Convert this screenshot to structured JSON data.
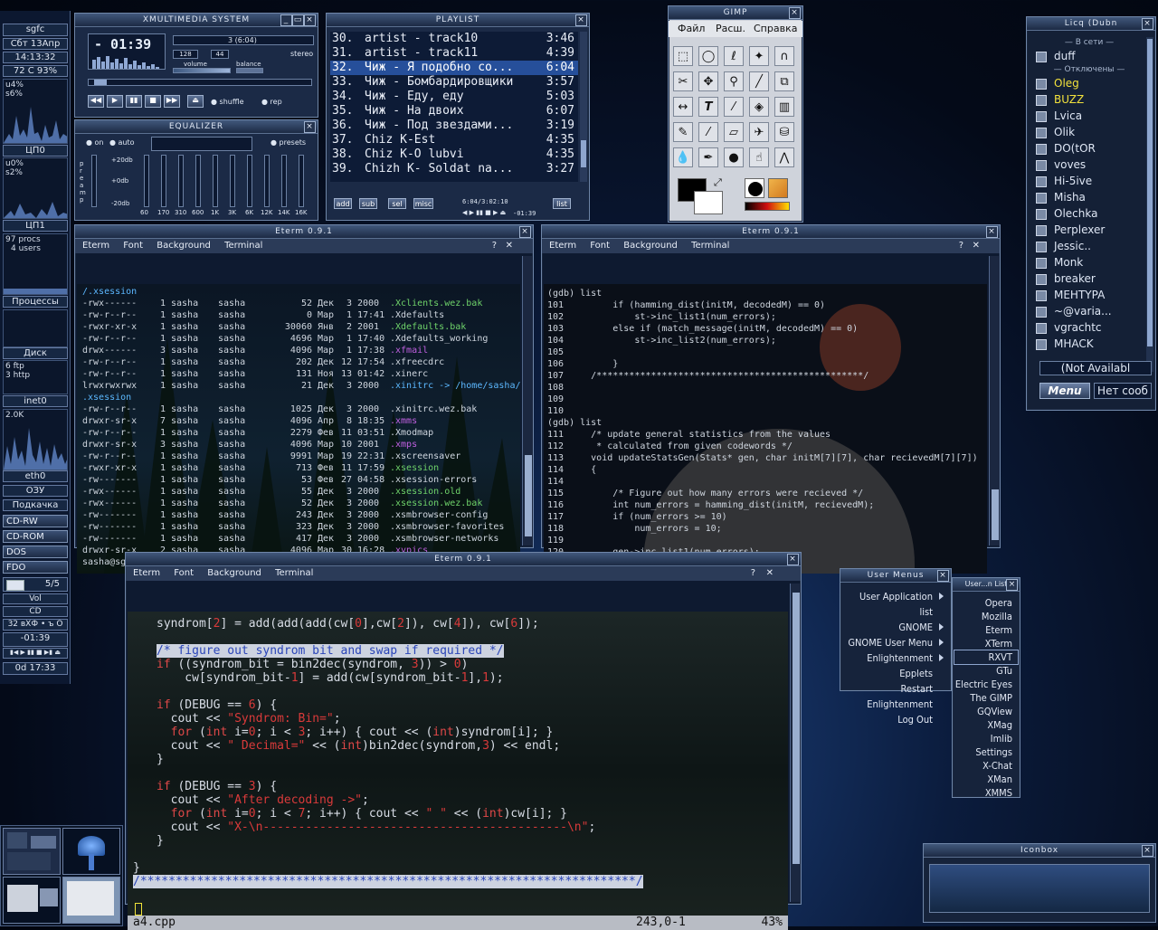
{
  "left_panel": {
    "host": "sgfc",
    "date": "Сбт 13Апр",
    "time": "14:13:32",
    "temp": "72 C 93%",
    "cpu0_pct": "u4%",
    "cpu0_sys": "s6%",
    "cpu0_label": "ЦП0",
    "cpu1_pct": "u0%",
    "cpu1_sys": "s2%",
    "cpu1_label": "ЦП1",
    "procs": "97 procs",
    "users": "4 users",
    "proc_label": "Процессы",
    "disk_label": "Диск",
    "ftp": "6 ftp",
    "http": "3 http",
    "inet_label": "inet0",
    "net_rate": "2.0K",
    "eth_label": "eth0",
    "ozu": "ОЗУ",
    "swap": "Подкачка",
    "mounts": [
      "CD-RW",
      "CD-ROM",
      "DOS",
      "FDO"
    ],
    "mail": "5/5",
    "vol": "Vol",
    "cd": "CD",
    "cd_info": "32 вХФ • ъ О",
    "cd_time": "-01:39",
    "uptime": "0d 17:33"
  },
  "xmms": {
    "title": "XMULTIMEDIA SYSTEM",
    "time": "- 01:39",
    "kbps": "128",
    "khz": "44",
    "stereo": "stereo",
    "volume": "volume",
    "balance": "balance",
    "shuffle": "shuffle",
    "rep": "rep",
    "song": "3 (6:04)",
    "eq_title": "EQUALIZER",
    "eq_on": "on",
    "eq_auto": "auto",
    "eq_presets": "presets",
    "eq_db": [
      "+20db",
      "+0db",
      "-20db"
    ],
    "eq_bands": [
      "60",
      "170",
      "310",
      "600",
      "1K",
      "3K",
      "6K",
      "12K",
      "14K",
      "16K"
    ],
    "eq_preamp": "preamp"
  },
  "playlist": {
    "title": "PLAYLIST",
    "rows": [
      {
        "num": "30.",
        "name": "artist - track10",
        "dur": "3:46"
      },
      {
        "num": "31.",
        "name": "artist - track11",
        "dur": "4:39"
      },
      {
        "num": "32.",
        "name": "Чиж - Я подобно со...",
        "dur": "6:04"
      },
      {
        "num": "33.",
        "name": "Чиж - Бомбардировщики",
        "dur": "3:57"
      },
      {
        "num": "34.",
        "name": "Чиж - Еду, еду",
        "dur": "5:03"
      },
      {
        "num": "35.",
        "name": "Чиж - На двоих",
        "dur": "6:07"
      },
      {
        "num": "36.",
        "name": "Чиж - Под звездами...",
        "dur": "3:19"
      },
      {
        "num": "37.",
        "name": "Chiz K-Est",
        "dur": "4:35"
      },
      {
        "num": "38.",
        "name": "Chiz K-O lubvi",
        "dur": "4:35"
      },
      {
        "num": "39.",
        "name": "Chizh K- Soldat na...",
        "dur": "3:27"
      }
    ],
    "buttons": [
      "add",
      "sub",
      "sel",
      "misc",
      "list"
    ],
    "info": "6:04/3:02:10",
    "remain": "-01:39"
  },
  "gimp": {
    "title": "GIMP",
    "menu": [
      "Файл",
      "Расш.",
      "Справка"
    ]
  },
  "eterm_left": {
    "title": "Eterm 0.9.1",
    "menu": [
      "Eterm",
      "Font",
      "Background",
      "Terminal"
    ],
    "header": "/.xsession",
    "rows": [
      {
        "perm": "-rwx------",
        "n": "1",
        "u": "sasha",
        "g": "sasha",
        "size": "52",
        "mon": "Дек",
        "day": "3",
        "t": "2000",
        "name": ".Xclients.wez.bak",
        "c": "grn"
      },
      {
        "perm": "-rw-r--r--",
        "n": "1",
        "u": "sasha",
        "g": "sasha",
        "size": "0",
        "mon": "Мар",
        "day": "1",
        "t": "17:41",
        "name": ".Xdefaults",
        "c": ""
      },
      {
        "perm": "-rwxr-xr-x",
        "n": "1",
        "u": "sasha",
        "g": "sasha",
        "size": "30060",
        "mon": "Янв",
        "day": "2",
        "t": "2001",
        "name": ".Xdefaults.bak",
        "c": "grn"
      },
      {
        "perm": "-rw-r--r--",
        "n": "1",
        "u": "sasha",
        "g": "sasha",
        "size": "4696",
        "mon": "Мар",
        "day": "1",
        "t": "17:40",
        "name": ".Xdefaults_working",
        "c": ""
      },
      {
        "perm": "drwx------",
        "n": "3",
        "u": "sasha",
        "g": "sasha",
        "size": "4096",
        "mon": "Мар",
        "day": "1",
        "t": "17:38",
        "name": ".xfmail",
        "c": "mag"
      },
      {
        "perm": "-rw-r--r--",
        "n": "1",
        "u": "sasha",
        "g": "sasha",
        "size": "202",
        "mon": "Дек",
        "day": "12",
        "t": "17:54",
        "name": ".xfreecdrc",
        "c": ""
      },
      {
        "perm": "-rw-r--r--",
        "n": "1",
        "u": "sasha",
        "g": "sasha",
        "size": "131",
        "mon": "Ноя",
        "day": "13",
        "t": "01:42",
        "name": ".xinerc",
        "c": ""
      },
      {
        "perm": "lrwxrwxrwx",
        "n": "1",
        "u": "sasha",
        "g": "sasha",
        "size": "21",
        "mon": "Дек",
        "day": "3",
        "t": "2000",
        "name": ".xinitrc -> /home/sasha/",
        "c": "cyanf"
      },
      {
        "perm": ".xsession",
        "n": "",
        "u": "",
        "g": "",
        "size": "",
        "mon": "",
        "day": "",
        "t": "",
        "name": "",
        "c": "cyanf"
      },
      {
        "perm": "-rw-r--r--",
        "n": "1",
        "u": "sasha",
        "g": "sasha",
        "size": "1025",
        "mon": "Дек",
        "day": "3",
        "t": "2000",
        "name": ".xinitrc.wez.bak",
        "c": ""
      },
      {
        "perm": "drwxr-sr-x",
        "n": "7",
        "u": "sasha",
        "g": "sasha",
        "size": "4096",
        "mon": "Апр",
        "day": "8",
        "t": "18:35",
        "name": ".xmms",
        "c": "mag"
      },
      {
        "perm": "-rw-r--r--",
        "n": "1",
        "u": "sasha",
        "g": "sasha",
        "size": "2279",
        "mon": "Фев",
        "day": "11",
        "t": "03:51",
        "name": ".Xmodmap",
        "c": ""
      },
      {
        "perm": "drwxr-sr-x",
        "n": "3",
        "u": "sasha",
        "g": "sasha",
        "size": "4096",
        "mon": "Мар",
        "day": "10",
        "t": "2001",
        "name": ".xmps",
        "c": "mag"
      },
      {
        "perm": "-rw-r--r--",
        "n": "1",
        "u": "sasha",
        "g": "sasha",
        "size": "9991",
        "mon": "Мар",
        "day": "19",
        "t": "22:31",
        "name": ".xscreensaver",
        "c": ""
      },
      {
        "perm": "-rwxr-xr-x",
        "n": "1",
        "u": "sasha",
        "g": "sasha",
        "size": "713",
        "mon": "Фев",
        "day": "11",
        "t": "17:59",
        "name": ".xsession",
        "c": "grn"
      },
      {
        "perm": "-rw-------",
        "n": "1",
        "u": "sasha",
        "g": "sasha",
        "size": "53",
        "mon": "Фев",
        "day": "27",
        "t": "04:58",
        "name": ".xsession-errors",
        "c": ""
      },
      {
        "perm": "-rwx------",
        "n": "1",
        "u": "sasha",
        "g": "sasha",
        "size": "55",
        "mon": "Дек",
        "day": "3",
        "t": "2000",
        "name": ".xsession.old",
        "c": "grn"
      },
      {
        "perm": "-rwx------",
        "n": "1",
        "u": "sasha",
        "g": "sasha",
        "size": "52",
        "mon": "Дек",
        "day": "3",
        "t": "2000",
        "name": ".xsession.wez.bak",
        "c": "grn"
      },
      {
        "perm": "-rw-------",
        "n": "1",
        "u": "sasha",
        "g": "sasha",
        "size": "243",
        "mon": "Дек",
        "day": "3",
        "t": "2000",
        "name": ".xsmbrowser-config",
        "c": ""
      },
      {
        "perm": "-rw-------",
        "n": "1",
        "u": "sasha",
        "g": "sasha",
        "size": "323",
        "mon": "Дек",
        "day": "3",
        "t": "2000",
        "name": ".xsmbrowser-favorites",
        "c": ""
      },
      {
        "perm": "-rw-------",
        "n": "1",
        "u": "sasha",
        "g": "sasha",
        "size": "417",
        "mon": "Дек",
        "day": "3",
        "t": "2000",
        "name": ".xsmbrowser-networks",
        "c": ""
      },
      {
        "perm": "drwxr-sr-x",
        "n": "2",
        "u": "sasha",
        "g": "sasha",
        "size": "4096",
        "mon": "Мар",
        "day": "30",
        "t": "16:28",
        "name": ".xvpics",
        "c": "mag"
      }
    ],
    "prompt": "sasha@sgfc:~$ "
  },
  "eterm_right": {
    "title": "Eterm 0.9.1",
    "menu": [
      "Eterm",
      "Font",
      "Background",
      "Terminal"
    ],
    "lines": [
      "(gdb) list",
      "101         if (hamming_dist(initM, decodedM) == 0)",
      "102             st->inc_list1(num_errors);",
      "103         else if (match_message(initM, decodedM) == 0)",
      "104             st->inc_list2(num_errors);",
      "105",
      "106         }",
      "107     /*************************************************/",
      "108",
      "109",
      "110",
      "(gdb) list",
      "111     /* update general statistics from the values",
      "112      * calculated from given codewords */",
      "113     void updateStatsGen(Stats* gen, char initM[7][7], char recievedM[7][7])",
      "114     {",
      "114",
      "115         /* Figure out how many errors were recieved */",
      "116         int num_errors = hamming_dist(initM, recievedM);",
      "117         if (num_errors >= 10)",
      "118             num_errors = 10;",
      "119",
      "120         gen->inc_list1(num_errors);",
      "(gdb) "
    ]
  },
  "eterm_bottom": {
    "title": "Eterm 0.9.1",
    "menu": [
      "Eterm",
      "Font",
      "Background",
      "Terminal"
    ],
    "status_file": "a4.cpp",
    "status_pos": "243,0-1",
    "status_pct": "43%"
  },
  "licq": {
    "title": "Licq (Dubn",
    "online_header": "В сети",
    "offline_header": "Отключены",
    "online": [
      "duff"
    ],
    "offline": [
      "Oleg",
      "BUZZ",
      "Lvica",
      "Olik",
      "DO(tOR",
      "voves",
      "Hi-5ive",
      "Misha",
      "Olechka",
      "Perplexer",
      "Jessic..",
      "Monk",
      "breaker",
      "MEHTYPA",
      "~@varia...",
      "vgrachtc",
      "MHACK"
    ],
    "status": "(Not Availabl",
    "menu_btn": "Menu",
    "msg_btn": "Нет сооб"
  },
  "user_menus": {
    "title": "User Menus",
    "items": [
      "User Application list",
      "GNOME",
      "GNOME User Menu",
      "Enlightenment Epplets",
      "Restart Enlightenment",
      "Log Out"
    ]
  },
  "user_list": {
    "title": "User...n List",
    "items": [
      "Opera",
      "Mozilla",
      "Eterm",
      "XTerm",
      "RXVT",
      "GTu",
      "Electric Eyes",
      "The GIMP",
      "GQView",
      "XMag",
      "Imlib Settings",
      "X-Chat",
      "XMan",
      "XMMS"
    ]
  },
  "iconbox": {
    "title": "Iconbox"
  },
  "colors": {
    "selected": "#264f9a",
    "comment": "#5577dd",
    "keyword": "#e04848"
  }
}
